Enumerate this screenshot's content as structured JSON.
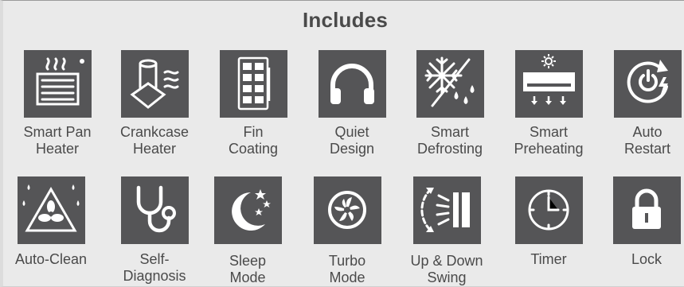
{
  "title": "Includes",
  "features": [
    {
      "icon": "smart-pan-heater-icon",
      "line1": "Smart Pan",
      "line2": "Heater"
    },
    {
      "icon": "crankcase-heater-icon",
      "line1": "Crankcase",
      "line2": "Heater"
    },
    {
      "icon": "fin-coating-icon",
      "line1": "Fin",
      "line2": "Coating"
    },
    {
      "icon": "quiet-design-icon",
      "line1": "Quiet",
      "line2": "Design"
    },
    {
      "icon": "smart-defrosting-icon",
      "line1": "Smart",
      "line2": "Defrosting"
    },
    {
      "icon": "smart-preheating-icon",
      "line1": "Smart",
      "line2": "Preheating"
    },
    {
      "icon": "auto-restart-icon",
      "line1": "Auto",
      "line2": "Restart"
    },
    {
      "icon": "auto-clean-icon",
      "line1": "Auto-Clean",
      "line2": ""
    },
    {
      "icon": "self-diagnosis-icon",
      "line1": "Self-",
      "line2": "Diagnosis"
    },
    {
      "icon": "sleep-mode-icon",
      "line1": "Sleep",
      "line2": "Mode"
    },
    {
      "icon": "turbo-mode-icon",
      "line1": "Turbo",
      "line2": "Mode"
    },
    {
      "icon": "up-down-swing-icon",
      "line1": "Up & Down",
      "line2": "Swing"
    },
    {
      "icon": "timer-icon",
      "line1": "Timer",
      "line2": ""
    },
    {
      "icon": "lock-icon",
      "line1": "Lock",
      "line2": ""
    }
  ],
  "colors": {
    "icon_bg": "#555557",
    "icon_fg": "#ffffff",
    "text": "#4a4a4a",
    "panel_bg": "#eaeaea"
  }
}
